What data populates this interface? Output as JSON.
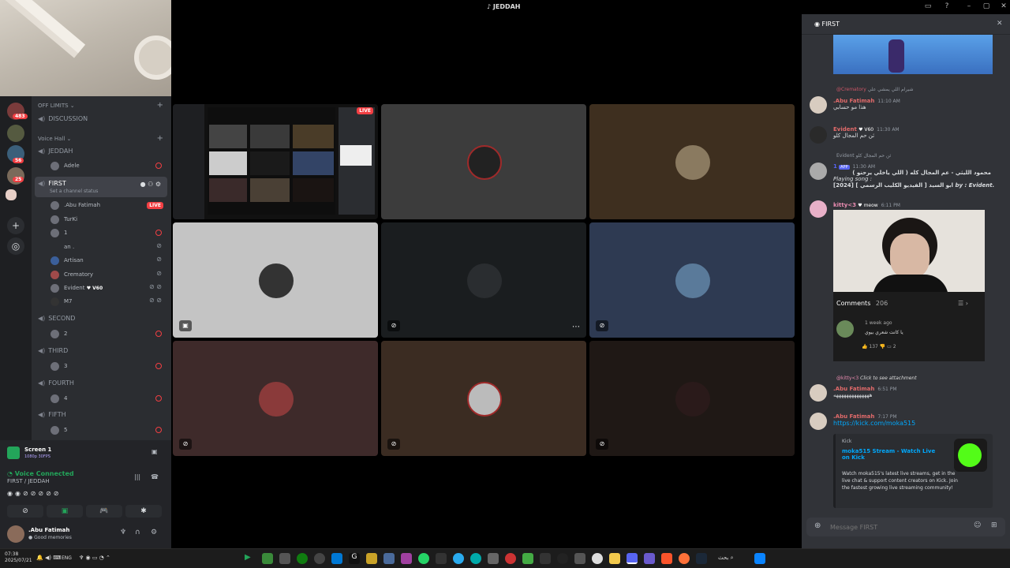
{
  "window": {
    "title": "JEDDAH"
  },
  "webcam": {
    "label": "webcam-feed"
  },
  "servers": {
    "badges": [
      "483",
      "56",
      "25"
    ]
  },
  "channels": {
    "off_limits": "OFF LIMITS",
    "discussion": "DISCUSSION",
    "voice_hall": "Voice Hall",
    "jeddah": "JEDDAH",
    "jeddah_users": [
      "Adele"
    ],
    "first": "FIRST",
    "set_status": "Set a channel status",
    "first_users": [
      ".Abu Fatimah",
      "TurKi",
      "1",
      "an .",
      "Artisan",
      "Crematory",
      "Evident",
      "M7"
    ],
    "evident_tag": "V60",
    "live": "LIVE",
    "second": "SECOND",
    "second_users": [
      "2"
    ],
    "third": "THIRD",
    "third_users": [
      "3"
    ],
    "fourth": "FOURTH",
    "fourth_users": [
      "4"
    ],
    "fifth": "FIFTH",
    "fifth_users": [
      "5"
    ]
  },
  "stream_panel": {
    "title": "Screen 1",
    "quality": "1080p 30FPS"
  },
  "voice": {
    "status": "Voice Connected",
    "location": "FIRST / JEDDAH"
  },
  "user_panel": {
    "name": ".Abu Fatimah",
    "status": "Good memories"
  },
  "chat": {
    "channel": "FIRST",
    "messages": [
      {
        "reply_name": "@Crematory",
        "reply_text": "شيرام اللي يمشي علي",
        "name": ".Abu Fatimah",
        "time": "11:10 AM",
        "text": "هذا مو حسابي"
      },
      {
        "name": "Evident",
        "tag": "V60",
        "time": "11:30 AM",
        "text": "ثن حم المجال كلو"
      },
      {
        "reply_name": "Evident",
        "reply_text": "ثن حم المجال كلو",
        "name": "1",
        "app": "APP",
        "time": "11:30 AM",
        "text": "محمود الليثي - عم المجال كله ( اللي ياخلي يرحنو )  ",
        "playing": "Playing song :",
        "video_title": "[2024] [ الفيديو الكليب الرسمي ] ابو السيد",
        "by": "by : Evident."
      },
      {
        "name": "kitty<3",
        "tag": "meow",
        "time": "6:11 PM"
      },
      {
        "reply_name": "@kitty<3",
        "reply_text": "Click to see attachment",
        "name": ".Abu Fatimah",
        "time": "6:51 PM",
        "text": "ههههههههههههههه"
      },
      {
        "name": ".Abu Fatimah",
        "time": "7:17 PM",
        "link": "https://kick.com/moka515"
      }
    ],
    "comments": {
      "label": "Comments",
      "count": "206",
      "ago": "1 week ago",
      "text": "يا كانت شعري بيوي",
      "likes": "137",
      "replies": "2"
    },
    "embed": {
      "site": "Kick",
      "title": "moka515 Stream - Watch Live on Kick",
      "desc": "Watch moka515's latest live streams, get in the live chat & support content creators on Kick. Join the fastest growing live streaming community!"
    },
    "composer_placeholder": "Message FIRST"
  },
  "taskbar": {
    "time": "07:38",
    "date": "2025/07/21",
    "lang": "ENG",
    "search": "بحث"
  },
  "colors": {
    "accent": "#5865f2",
    "red": "#f23f43",
    "green": "#23a55a",
    "link": "#00a8fc"
  }
}
